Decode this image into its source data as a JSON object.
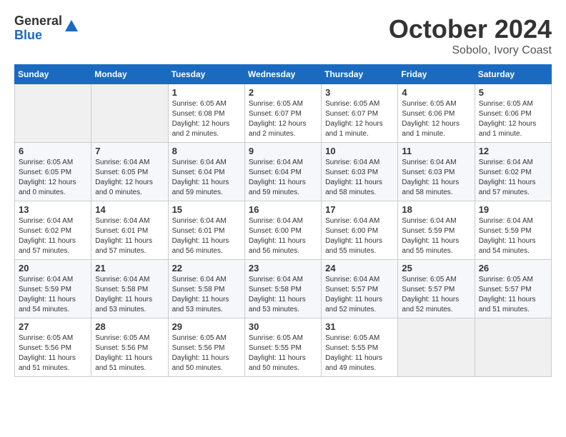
{
  "logo": {
    "general": "General",
    "blue": "Blue"
  },
  "title": "October 2024",
  "subtitle": "Sobolo, Ivory Coast",
  "days_of_week": [
    "Sunday",
    "Monday",
    "Tuesday",
    "Wednesday",
    "Thursday",
    "Friday",
    "Saturday"
  ],
  "weeks": [
    [
      {
        "day": "",
        "empty": true
      },
      {
        "day": "",
        "empty": true
      },
      {
        "day": "1",
        "sunrise": "Sunrise: 6:05 AM",
        "sunset": "Sunset: 6:08 PM",
        "daylight": "Daylight: 12 hours and 2 minutes."
      },
      {
        "day": "2",
        "sunrise": "Sunrise: 6:05 AM",
        "sunset": "Sunset: 6:07 PM",
        "daylight": "Daylight: 12 hours and 2 minutes."
      },
      {
        "day": "3",
        "sunrise": "Sunrise: 6:05 AM",
        "sunset": "Sunset: 6:07 PM",
        "daylight": "Daylight: 12 hours and 1 minute."
      },
      {
        "day": "4",
        "sunrise": "Sunrise: 6:05 AM",
        "sunset": "Sunset: 6:06 PM",
        "daylight": "Daylight: 12 hours and 1 minute."
      },
      {
        "day": "5",
        "sunrise": "Sunrise: 6:05 AM",
        "sunset": "Sunset: 6:06 PM",
        "daylight": "Daylight: 12 hours and 1 minute."
      }
    ],
    [
      {
        "day": "6",
        "sunrise": "Sunrise: 6:05 AM",
        "sunset": "Sunset: 6:05 PM",
        "daylight": "Daylight: 12 hours and 0 minutes."
      },
      {
        "day": "7",
        "sunrise": "Sunrise: 6:04 AM",
        "sunset": "Sunset: 6:05 PM",
        "daylight": "Daylight: 12 hours and 0 minutes."
      },
      {
        "day": "8",
        "sunrise": "Sunrise: 6:04 AM",
        "sunset": "Sunset: 6:04 PM",
        "daylight": "Daylight: 11 hours and 59 minutes."
      },
      {
        "day": "9",
        "sunrise": "Sunrise: 6:04 AM",
        "sunset": "Sunset: 6:04 PM",
        "daylight": "Daylight: 11 hours and 59 minutes."
      },
      {
        "day": "10",
        "sunrise": "Sunrise: 6:04 AM",
        "sunset": "Sunset: 6:03 PM",
        "daylight": "Daylight: 11 hours and 58 minutes."
      },
      {
        "day": "11",
        "sunrise": "Sunrise: 6:04 AM",
        "sunset": "Sunset: 6:03 PM",
        "daylight": "Daylight: 11 hours and 58 minutes."
      },
      {
        "day": "12",
        "sunrise": "Sunrise: 6:04 AM",
        "sunset": "Sunset: 6:02 PM",
        "daylight": "Daylight: 11 hours and 57 minutes."
      }
    ],
    [
      {
        "day": "13",
        "sunrise": "Sunrise: 6:04 AM",
        "sunset": "Sunset: 6:02 PM",
        "daylight": "Daylight: 11 hours and 57 minutes."
      },
      {
        "day": "14",
        "sunrise": "Sunrise: 6:04 AM",
        "sunset": "Sunset: 6:01 PM",
        "daylight": "Daylight: 11 hours and 57 minutes."
      },
      {
        "day": "15",
        "sunrise": "Sunrise: 6:04 AM",
        "sunset": "Sunset: 6:01 PM",
        "daylight": "Daylight: 11 hours and 56 minutes."
      },
      {
        "day": "16",
        "sunrise": "Sunrise: 6:04 AM",
        "sunset": "Sunset: 6:00 PM",
        "daylight": "Daylight: 11 hours and 56 minutes."
      },
      {
        "day": "17",
        "sunrise": "Sunrise: 6:04 AM",
        "sunset": "Sunset: 6:00 PM",
        "daylight": "Daylight: 11 hours and 55 minutes."
      },
      {
        "day": "18",
        "sunrise": "Sunrise: 6:04 AM",
        "sunset": "Sunset: 5:59 PM",
        "daylight": "Daylight: 11 hours and 55 minutes."
      },
      {
        "day": "19",
        "sunrise": "Sunrise: 6:04 AM",
        "sunset": "Sunset: 5:59 PM",
        "daylight": "Daylight: 11 hours and 54 minutes."
      }
    ],
    [
      {
        "day": "20",
        "sunrise": "Sunrise: 6:04 AM",
        "sunset": "Sunset: 5:59 PM",
        "daylight": "Daylight: 11 hours and 54 minutes."
      },
      {
        "day": "21",
        "sunrise": "Sunrise: 6:04 AM",
        "sunset": "Sunset: 5:58 PM",
        "daylight": "Daylight: 11 hours and 53 minutes."
      },
      {
        "day": "22",
        "sunrise": "Sunrise: 6:04 AM",
        "sunset": "Sunset: 5:58 PM",
        "daylight": "Daylight: 11 hours and 53 minutes."
      },
      {
        "day": "23",
        "sunrise": "Sunrise: 6:04 AM",
        "sunset": "Sunset: 5:58 PM",
        "daylight": "Daylight: 11 hours and 53 minutes."
      },
      {
        "day": "24",
        "sunrise": "Sunrise: 6:04 AM",
        "sunset": "Sunset: 5:57 PM",
        "daylight": "Daylight: 11 hours and 52 minutes."
      },
      {
        "day": "25",
        "sunrise": "Sunrise: 6:05 AM",
        "sunset": "Sunset: 5:57 PM",
        "daylight": "Daylight: 11 hours and 52 minutes."
      },
      {
        "day": "26",
        "sunrise": "Sunrise: 6:05 AM",
        "sunset": "Sunset: 5:57 PM",
        "daylight": "Daylight: 11 hours and 51 minutes."
      }
    ],
    [
      {
        "day": "27",
        "sunrise": "Sunrise: 6:05 AM",
        "sunset": "Sunset: 5:56 PM",
        "daylight": "Daylight: 11 hours and 51 minutes."
      },
      {
        "day": "28",
        "sunrise": "Sunrise: 6:05 AM",
        "sunset": "Sunset: 5:56 PM",
        "daylight": "Daylight: 11 hours and 51 minutes."
      },
      {
        "day": "29",
        "sunrise": "Sunrise: 6:05 AM",
        "sunset": "Sunset: 5:56 PM",
        "daylight": "Daylight: 11 hours and 50 minutes."
      },
      {
        "day": "30",
        "sunrise": "Sunrise: 6:05 AM",
        "sunset": "Sunset: 5:55 PM",
        "daylight": "Daylight: 11 hours and 50 minutes."
      },
      {
        "day": "31",
        "sunrise": "Sunrise: 6:05 AM",
        "sunset": "Sunset: 5:55 PM",
        "daylight": "Daylight: 11 hours and 49 minutes."
      },
      {
        "day": "",
        "empty": true
      },
      {
        "day": "",
        "empty": true
      }
    ]
  ]
}
